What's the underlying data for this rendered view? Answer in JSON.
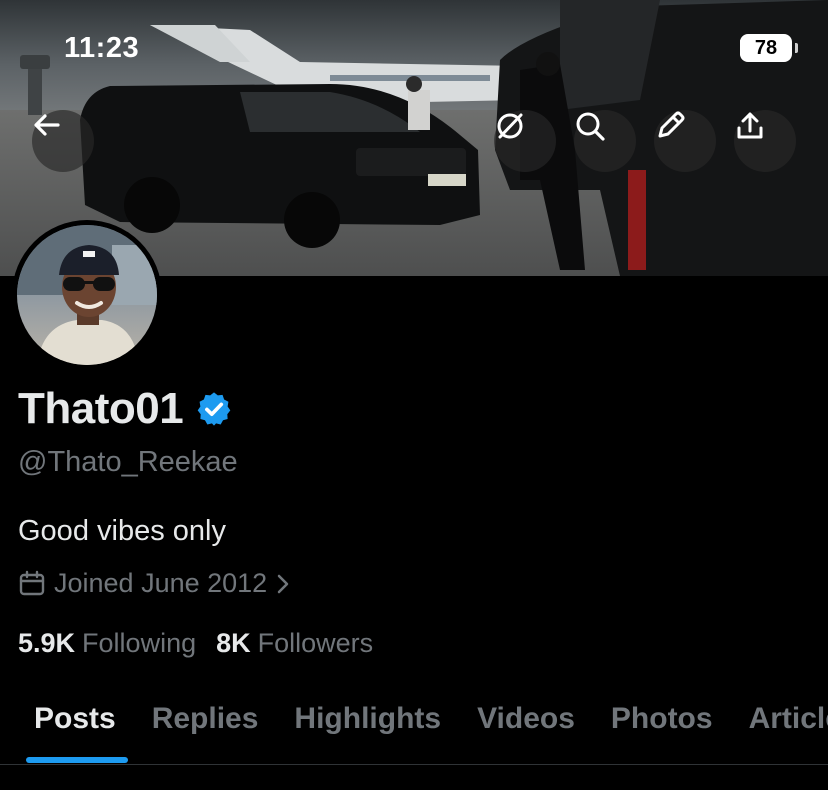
{
  "status_bar": {
    "time": "11:23",
    "battery": "78"
  },
  "header_buttons": {
    "back": "back-arrow-icon",
    "grok": "grok-icon",
    "search": "search-icon",
    "edit": "pencil-icon",
    "share": "share-icon"
  },
  "profile": {
    "display_name": "Thato01",
    "handle": "@Thato_Reekae",
    "bio": "Good vibes only",
    "joined": "Joined June 2012",
    "following_count": "5.9K",
    "following_label": "Following",
    "followers_count": "8K",
    "followers_label": "Followers",
    "verified_color": "#1d9bf0"
  },
  "tabs": [
    {
      "label": "Posts",
      "active": true
    },
    {
      "label": "Replies"
    },
    {
      "label": "Highlights"
    },
    {
      "label": "Videos"
    },
    {
      "label": "Photos"
    },
    {
      "label": "Articles"
    }
  ],
  "colors": {
    "accent": "#1d9bf0",
    "muted": "#71767b",
    "text": "#e7e9ea",
    "background": "#000000"
  }
}
